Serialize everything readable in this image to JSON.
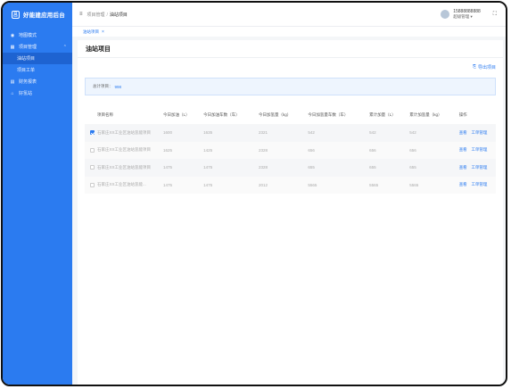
{
  "brand": {
    "name": "好能建应用后台",
    "logo_glyph": "吕"
  },
  "sidebar": {
    "items": [
      {
        "label": "地图模式",
        "icon": "map-pin-icon"
      },
      {
        "label": "项目管理",
        "icon": "grid-icon",
        "expanded": true
      },
      {
        "label": "油站项目",
        "sub": true,
        "active": true
      },
      {
        "label": "项目工单",
        "sub": true
      },
      {
        "label": "财务报表",
        "icon": "report-icon"
      },
      {
        "label": "好氢站",
        "icon": "station-icon"
      }
    ]
  },
  "header": {
    "breadcrumb": [
      "项目管理",
      "油站项目"
    ],
    "user_phone": "15888888888",
    "user_role": "超级管理"
  },
  "tabs": [
    {
      "label": "油站项目"
    }
  ],
  "page": {
    "title": "油站项目",
    "export_label": "导出项目"
  },
  "summary": {
    "label": "总计项目：",
    "value": "998"
  },
  "table": {
    "headers": [
      "项目名称",
      "今日加油（L）",
      "今日加油车数（车）",
      "今日加氢量（kg）",
      "今日加氢量车数（车）",
      "累计加量（L）",
      "累计加氢量（kg）",
      "操作"
    ],
    "rows": [
      {
        "checked": true,
        "cells": [
          "石家庄XX工业区油站氢能项目",
          "1600",
          "1635",
          "2321",
          "542",
          "542",
          "542"
        ]
      },
      {
        "checked": false,
        "cells": [
          "石家庄XX工业区油站氢能项目",
          "1625",
          "1425",
          "2328",
          "656",
          "656",
          "656"
        ]
      },
      {
        "checked": false,
        "cells": [
          "石家庄XX工业区油站氢能项目",
          "1475",
          "1475",
          "2328",
          "655",
          "655",
          "655"
        ]
      },
      {
        "checked": false,
        "cells": [
          "石家庄XX工业区油站氢能...",
          "1475",
          "1475",
          "2012",
          "5565",
          "5565",
          "5565"
        ]
      }
    ],
    "action_view": "查看",
    "action_manage": "工单管理"
  },
  "colors": {
    "primary": "#2b7bf0",
    "sidebar_active": "#1e63d1"
  }
}
